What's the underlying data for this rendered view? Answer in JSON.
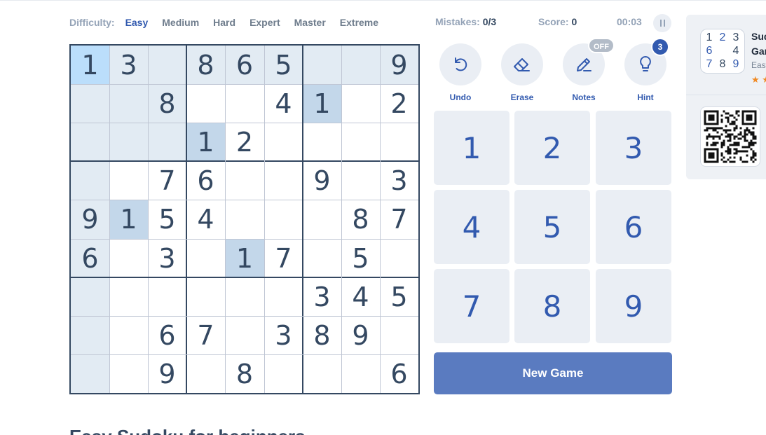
{
  "difficulty": {
    "label": "Difficulty:",
    "levels": [
      "Easy",
      "Medium",
      "Hard",
      "Expert",
      "Master",
      "Extreme"
    ],
    "active": "Easy"
  },
  "stats": {
    "mistakes_label": "Mistakes:",
    "mistakes_value": "0/3",
    "score_label": "Score:",
    "score_value": "0",
    "timer": "00:03"
  },
  "board": {
    "selected": [
      0,
      0
    ],
    "rows": [
      [
        "1",
        "3",
        "",
        "8",
        "6",
        "5",
        "",
        "",
        "9"
      ],
      [
        "",
        "",
        "8",
        "",
        "",
        "4",
        "1",
        "",
        "2"
      ],
      [
        "",
        "",
        "",
        "1",
        "2",
        "",
        "",
        "",
        ""
      ],
      [
        "",
        "",
        "7",
        "6",
        "",
        "",
        "9",
        "",
        "3"
      ],
      [
        "9",
        "1",
        "5",
        "4",
        "",
        "",
        "",
        "8",
        "7"
      ],
      [
        "6",
        "",
        "3",
        "",
        "1",
        "7",
        "",
        "5",
        ""
      ],
      [
        "",
        "",
        "",
        "",
        "",
        "",
        "3",
        "4",
        "5"
      ],
      [
        "",
        "",
        "6",
        "7",
        "",
        "3",
        "8",
        "9",
        ""
      ],
      [
        "",
        "",
        "9",
        "",
        "8",
        "",
        "",
        "",
        "6"
      ]
    ]
  },
  "controls": {
    "undo": "Undo",
    "erase": "Erase",
    "notes": "Notes",
    "notes_state": "OFF",
    "hint": "Hint",
    "hint_count": "3"
  },
  "numpad": [
    "1",
    "2",
    "3",
    "4",
    "5",
    "6",
    "7",
    "8",
    "9"
  ],
  "new_game": "New Game",
  "below_title": "Easy Sudoku for beginners",
  "side_app": {
    "name_line1": "Sudoku",
    "name_line2": "Game",
    "level": "Easy",
    "stars": "★ ★ ★ ★ ★",
    "icon_grid": [
      "1",
      "2",
      "3",
      "6",
      "",
      "4",
      "7",
      "8",
      "9"
    ]
  },
  "colors": {
    "accent": "#325aaf",
    "board_border": "#344861",
    "related_highlight": "#e2ebf3",
    "same_number_highlight": "#c3d7ea",
    "selected_cell": "#bbdefb",
    "new_game_button": "#5a7bc0"
  }
}
